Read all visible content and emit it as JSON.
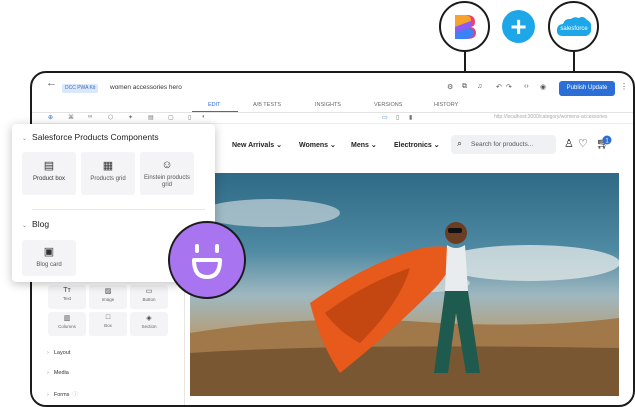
{
  "editor": {
    "site_badge": "DCC PWA Kit",
    "page_name": "women accessories hero",
    "publish_label": "Publish Update",
    "tabs": [
      {
        "label": "EDIT",
        "active": true
      },
      {
        "label": "A/B TESTS",
        "active": false
      },
      {
        "label": "INSIGHTS",
        "active": false
      },
      {
        "label": "VERSIONS",
        "active": false
      },
      {
        "label": "HISTORY",
        "active": false
      }
    ],
    "preview_url": "http://localhost:3000/category/womens-accessories"
  },
  "logos": {
    "salesforce_text": "salesforce",
    "plus": "+"
  },
  "storefront": {
    "nav": [
      "New Arrivals",
      "Womens",
      "Mens",
      "Electronics"
    ],
    "search_placeholder": "Search for products...",
    "cart_count": "1"
  },
  "popup": {
    "section1_title": "Salesforce Products Components",
    "tiles": [
      {
        "label": "Product box",
        "icon": "product-box-icon"
      },
      {
        "label": "Products grid",
        "icon": "products-grid-icon"
      },
      {
        "label": "Einstein products grid",
        "icon": "einstein-icon"
      }
    ],
    "section2_title": "Blog",
    "blog_tile": {
      "label": "Blog card",
      "icon": "blog-card-icon"
    }
  },
  "sidebar": {
    "basic_tiles": [
      {
        "label": "Text",
        "glyph": "Tт"
      },
      {
        "label": "Image",
        "glyph": "▨"
      },
      {
        "label": "Button",
        "glyph": "▭"
      },
      {
        "label": "Columns",
        "glyph": "▥"
      },
      {
        "label": "Box",
        "glyph": "□"
      },
      {
        "label": "Section",
        "glyph": "◈"
      }
    ],
    "sections": [
      "Layout",
      "Media",
      "Forms"
    ]
  },
  "colors": {
    "accent": "#2b6fd6",
    "salesforce_blue": "#1ea7e8",
    "smiley_purple": "#a874f0"
  }
}
